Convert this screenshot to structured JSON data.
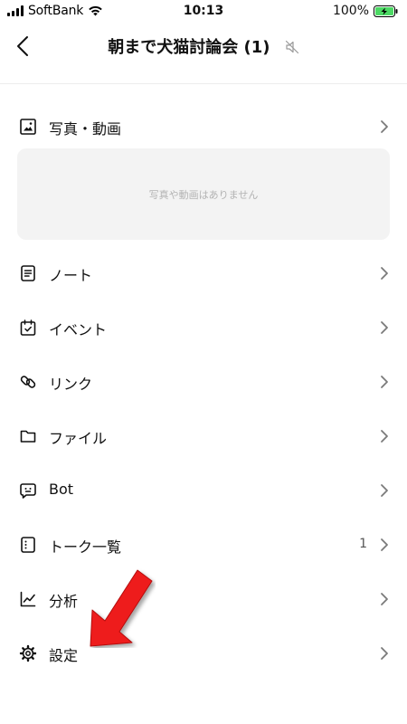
{
  "status_bar": {
    "carrier": "SoftBank",
    "time": "10:13",
    "battery": "100%"
  },
  "header": {
    "title": "朝まで犬猫討論会 (1)",
    "back_icon": "chevron-left-icon",
    "mute_icon": "speaker-muted-icon"
  },
  "media": {
    "label": "写真・動画",
    "empty_text": "写真や動画はありません"
  },
  "menu": [
    {
      "id": "note",
      "label": "ノート",
      "icon": "note-icon"
    },
    {
      "id": "event",
      "label": "イベント",
      "icon": "calendar-icon"
    },
    {
      "id": "link",
      "label": "リンク",
      "icon": "link-icon"
    },
    {
      "id": "file",
      "label": "ファイル",
      "icon": "folder-icon"
    },
    {
      "id": "bot",
      "label": "Bot",
      "icon": "bot-icon"
    },
    {
      "id": "talk-list",
      "label": "トーク一覧",
      "icon": "list-icon",
      "count": "1"
    },
    {
      "id": "analytics",
      "label": "分析",
      "icon": "chart-icon"
    },
    {
      "id": "settings",
      "label": "設定",
      "icon": "gear-icon"
    }
  ],
  "colors": {
    "text": "#111111",
    "divider": "#ececec",
    "media_bg": "#f3f3f3",
    "empty_text": "#b3b3b3",
    "chevron": "#7a7a7a",
    "battery_fill": "#4cd964",
    "annotation_arrow": "#ee1c1c"
  }
}
